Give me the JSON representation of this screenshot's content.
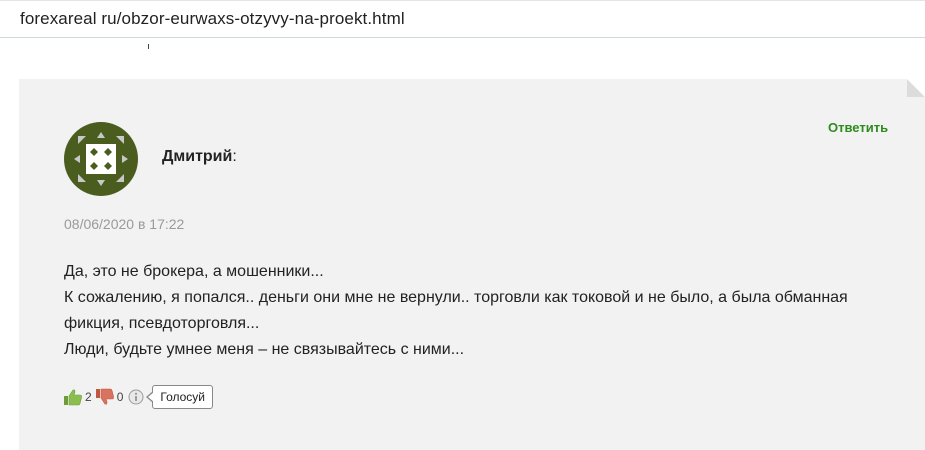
{
  "address_bar": {
    "url": "forexareal ru/obzor-eurwaxs-otzyvy-na-proekt.html"
  },
  "comment": {
    "author": "Дмитрий",
    "author_suffix": ":",
    "reply_label": "Ответить",
    "date": "08/06/2020 в 17:22",
    "lines": [
      "Да, это не брокера, а мошенники...",
      "К сожалению, я попался.. деньги они мне не вернули.. торговли как токовой и не было, а была обманная фикция, псевдоторговля...",
      "Люди, будьте умнее меня – не связывайтесь с ними..."
    ],
    "votes": {
      "likes": "2",
      "dislikes": "0",
      "vote_button_label": "Голосуй"
    }
  },
  "colors": {
    "reply": "#2e8b1e",
    "avatar_bg": "#4a5d1e",
    "card_bg": "#f2f2f2",
    "like": "#8bbf4d",
    "dislike": "#d9735f"
  },
  "icons": {
    "avatar": "identicon-avatar",
    "like": "thumbs-up-icon",
    "dislike": "thumbs-down-icon",
    "info": "info-icon"
  }
}
